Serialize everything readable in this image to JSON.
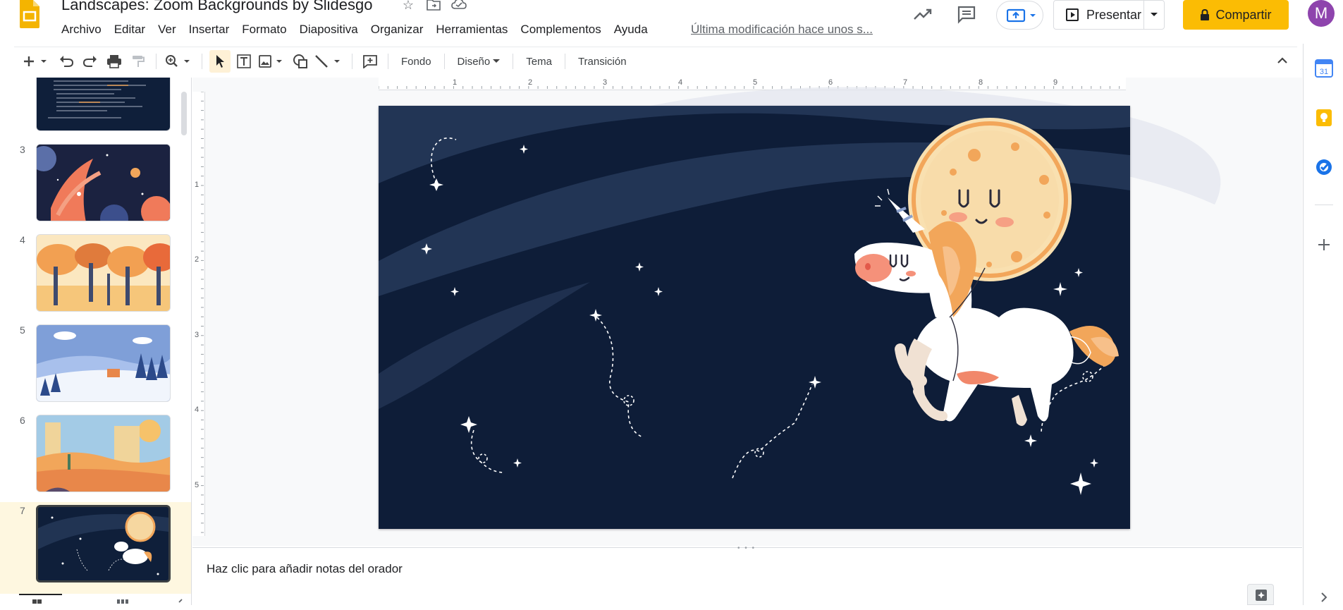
{
  "app": {
    "title": "Landscapes: Zoom Backgrounds by Slidesgo",
    "logo_icon": "google-slides-icon",
    "title_icons": [
      "star-icon",
      "move-to-folder-icon",
      "cloud-saved-icon"
    ]
  },
  "menu": {
    "items": [
      "Archivo",
      "Editar",
      "Ver",
      "Insertar",
      "Formato",
      "Diapositiva",
      "Organizar",
      "Herramientas",
      "Complementos",
      "Ayuda"
    ],
    "last_modified": "Última modificación hace unos s..."
  },
  "header_actions": {
    "activity_icon": "trending-up-icon",
    "comments_icon": "comment-icon",
    "upload_icon": "meet-present-icon",
    "present_label": "Presentar",
    "share_label": "Compartir",
    "avatar_letter": "M",
    "colors": {
      "share": "#fbbc04",
      "avatar": "#8e44ad",
      "upload": "#1a73e8"
    }
  },
  "toolbar": {
    "buttons": [
      "new-slide-icon",
      "undo-icon",
      "redo-icon",
      "print-icon",
      "paint-format-icon",
      "zoom-icon",
      "select-icon",
      "text-box-icon",
      "image-icon",
      "shape-icon",
      "line-icon",
      "comment-add-icon"
    ],
    "fondo": "Fondo",
    "diseno": "Diseño",
    "tema": "Tema",
    "transicion": "Transición"
  },
  "filmstrip": {
    "slides": [
      {
        "num": "",
        "theme": "text"
      },
      {
        "num": "3",
        "theme": "space"
      },
      {
        "num": "4",
        "theme": "autumn"
      },
      {
        "num": "5",
        "theme": "winter"
      },
      {
        "num": "6",
        "theme": "desert"
      },
      {
        "num": "7",
        "theme": "unicorn",
        "selected": true
      }
    ]
  },
  "ruler": {
    "h_numbers": [
      "1",
      "2",
      "3",
      "4",
      "5",
      "6",
      "7",
      "8",
      "9"
    ],
    "v_numbers": [
      "1",
      "2",
      "3",
      "4",
      "5"
    ]
  },
  "notes": {
    "placeholder": "Haz clic para añadir notas del orador"
  },
  "side_panel": {
    "icons": [
      "calendar-icon",
      "keep-icon",
      "tasks-icon",
      "add-icon"
    ],
    "calendar_day": "31"
  }
}
